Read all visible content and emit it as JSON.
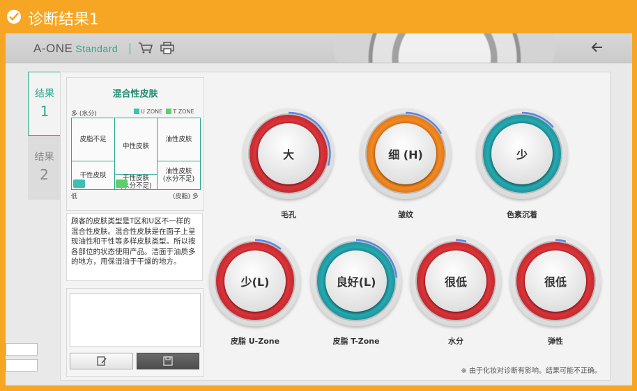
{
  "window": {
    "title": "诊断结果1"
  },
  "header": {
    "logo_main": "A-ONE",
    "logo_sub": "Standard"
  },
  "tabs": [
    {
      "label": "结果",
      "number": "1",
      "active": true
    },
    {
      "label": "结果",
      "number": "2",
      "active": false
    }
  ],
  "skin_type": {
    "title": "混合性皮肤",
    "y_axis_high": "多 (水分)",
    "x_axis_low": "低",
    "x_axis_high": "(皮脂) 多",
    "legend": [
      {
        "label": "U ZONE",
        "color": "#3cc0b4"
      },
      {
        "label": "T ZONE",
        "color": "#5ccf6a"
      }
    ],
    "cells": {
      "sebum_deficient": "皮脂不足",
      "neutral": "中性皮肤",
      "oily": "油性皮肤",
      "dry": "干性皮肤",
      "dry_water": "干性皮肤\n(水分不足)",
      "oily_water": "油性皮肤\n(水分不足)"
    },
    "description": "顾客的皮肤类型是T区和U区不一样的混合性皮肤。混合性皮肤是在面子上呈现油性和干性等多样皮肤类型。所以按各部位的状态使用产品。洁面于油质多的地方，用保湿油于干燥的地方。"
  },
  "gauges": [
    {
      "value": "大",
      "label": "毛孔",
      "color": "red"
    },
    {
      "value": "细 (H)",
      "label": "皱纹",
      "color": "orange"
    },
    {
      "value": "少",
      "label": "色素沉着",
      "color": "teal"
    },
    {
      "value": "少(L)",
      "label": "皮脂 U-Zone",
      "color": "red"
    },
    {
      "value": "良好(L)",
      "label": "皮脂 T-Zone",
      "color": "teal"
    },
    {
      "value": "很低",
      "label": "水分",
      "color": "red"
    },
    {
      "value": "很低",
      "label": "弹性",
      "color": "red"
    }
  ],
  "footer": {
    "note": "※ 由于化妆对诊断有影响。结果可能不正确。"
  }
}
